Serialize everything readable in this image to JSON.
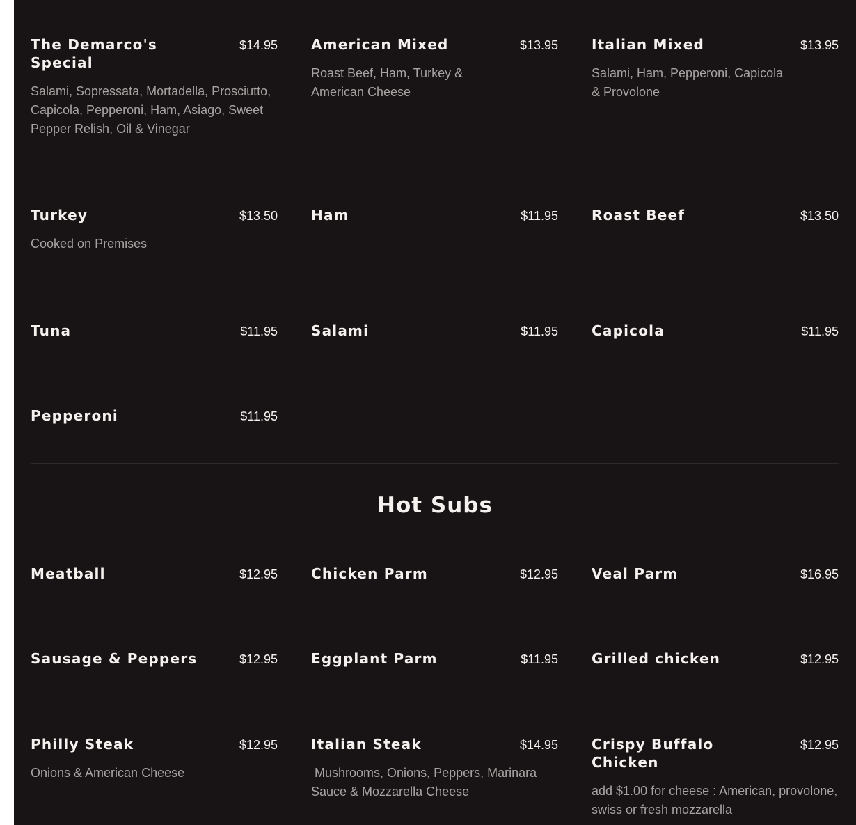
{
  "cold_subs": {
    "items": [
      {
        "name": "The Demarco's Special",
        "price": "$14.95",
        "desc": "Salami, Sopressata, Mortadella, Prosciutto, Capicola, Pepperoni, Ham, Asiago, Sweet Pepper Relish, Oil & Vinegar"
      },
      {
        "name": "American Mixed",
        "price": "$13.95",
        "desc": "Roast Beef, Ham, Turkey & American Cheese"
      },
      {
        "name": "Italian Mixed",
        "price": "$13.95",
        "desc": "Salami, Ham, Pepperoni, Capicola & Provolone"
      },
      {
        "name": "Turkey",
        "price": "$13.50",
        "desc": "Cooked on Premises"
      },
      {
        "name": "Ham",
        "price": "$11.95"
      },
      {
        "name": "Roast Beef",
        "price": "$13.50"
      },
      {
        "name": "Tuna",
        "price": "$11.95"
      },
      {
        "name": "Salami",
        "price": "$11.95"
      },
      {
        "name": "Capicola",
        "price": "$11.95"
      },
      {
        "name": "Pepperoni",
        "price": "$11.95"
      }
    ]
  },
  "hot_subs": {
    "title": "Hot Subs",
    "items": [
      {
        "name": "Meatball",
        "price": "$12.95"
      },
      {
        "name": "Chicken Parm",
        "price": "$12.95"
      },
      {
        "name": "Veal Parm",
        "price": "$16.95"
      },
      {
        "name": "Sausage & Peppers",
        "price": "$12.95"
      },
      {
        "name": "Eggplant Parm",
        "price": "$11.95"
      },
      {
        "name": "Grilled chicken",
        "price": "$12.95"
      },
      {
        "name": "Philly Steak",
        "price": "$12.95",
        "desc": "Onions & American Cheese"
      },
      {
        "name": "Italian Steak",
        "price": "$14.95",
        "desc": " Mushrooms, Onions, Peppers, Marinara Sauce & Mozzarella Cheese"
      },
      {
        "name": "Crispy Buffalo Chicken",
        "price": "$12.95",
        "desc": "add $1.00 for cheese : American, provolone, swiss or fresh mozzarella"
      }
    ]
  }
}
